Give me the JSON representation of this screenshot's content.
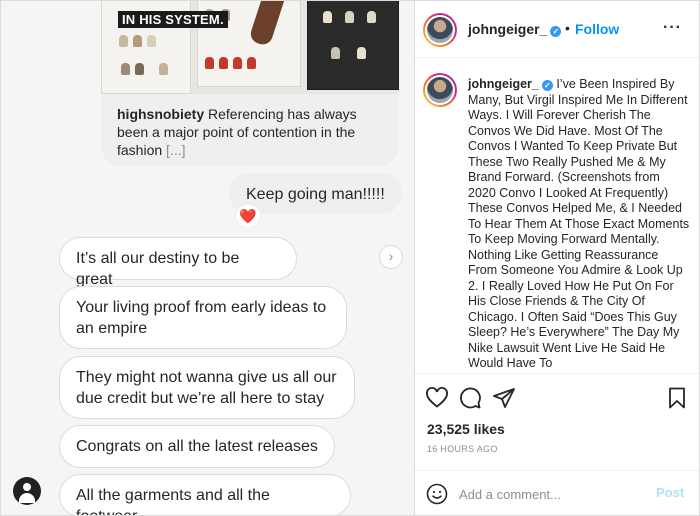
{
  "dm": {
    "shared_post": {
      "image_caption": "IN HIS SYSTEM.",
      "account": "highsnobiety",
      "text": "Referencing has always been a major point of contention in the fashion",
      "more": "[...]"
    },
    "sent_message": "Keep going man!!!!!",
    "reaction": "❤️",
    "received_messages": [
      "It’s all our destiny to be great",
      "Your living proof from early ideas to an empire",
      "They might not wanna give us all our due credit but we’re all here to stay",
      "Congrats on all the latest releases",
      "All the garments and all the footwear"
    ]
  },
  "post": {
    "username": "johngeiger_",
    "follow_label": "Follow",
    "separator": "•",
    "more_icon": "more-horizontal-icon",
    "caption": "I’ve Been Inspired By Many, But Virgil Inspired Me In Different Ways. I Will Forever Cherish The Convos We Did Have. Most Of The Convos I Wanted To Keep Private But These Two Really Pushed Me & My Brand Forward. (Screenshots from 2020 Convo I Looked At Frequently) These Convos Helped Me, & I Needed To Hear Them At Those Exact Moments To Keep Moving Forward Mentally. Nothing Like Getting Reassurance From Someone You Admire & Look Up 2. I Really Loved How He Put On For His Close Friends & The City Of Chicago. I Often Said “Does This Guy Sleep? He’s Everywhere” The Day My Nike Lawsuit Went Live He Said He Would Have To",
    "likes": "23,525 likes",
    "time": "16 HOURS AGO",
    "comment_placeholder": "Add a comment...",
    "post_label": "Post"
  },
  "colors": {
    "accent": "#0095f6",
    "verified": "#3897f0",
    "heart": "#ed4956",
    "post_disabled": "#b2dffc"
  }
}
